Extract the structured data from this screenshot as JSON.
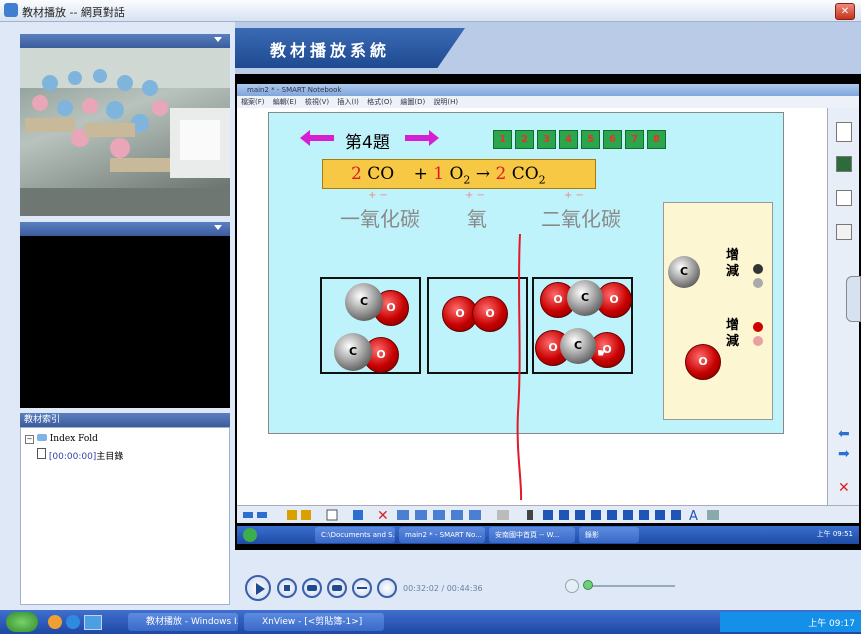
{
  "window": {
    "title": "教材播放 -- 網頁對話",
    "close_label": "✕"
  },
  "index": {
    "header": "教材索引",
    "folder": "Index Fold",
    "item_time": "[00:00:00]",
    "item_label": "主目錄"
  },
  "header": {
    "title": "教材播放系統"
  },
  "smart": {
    "title": "main2 * - SMART Notebook",
    "menu": [
      "檔案(F)",
      "編輯(E)",
      "檢視(V)",
      "插入(I)",
      "格式(O)",
      "繪圖(D)",
      "說明(H)"
    ]
  },
  "slide": {
    "question": "第4題",
    "page_buttons": [
      "1",
      "2",
      "3",
      "4",
      "5",
      "6",
      "7",
      "8"
    ],
    "equation": {
      "c1": "2",
      "t1": "CO",
      "plus": "+",
      "c2": "1",
      "t2": "O",
      "sub2": "2",
      "arrow": "→",
      "c3": "2",
      "t3": "CO",
      "sub3": "2"
    },
    "marks": [
      "+ −",
      "+ −",
      "+ −"
    ],
    "names": [
      "一氧化碳",
      "氧",
      "二氧化碳"
    ],
    "atom_c": "C",
    "atom_o": "O",
    "legend": {
      "label_c": "增\n減",
      "label_o": "增\n減"
    }
  },
  "inner_taskbar": {
    "items": [
      "C:\\Documents and S...",
      "main2 * - SMART No...",
      "安南國中首頁 -- W...",
      "錄影"
    ],
    "clock": "上午 09:51"
  },
  "player": {
    "time": "00:32:02 / 00:44:36"
  },
  "taskbar": {
    "items": [
      "教材播放 - Windows I...",
      "XnView - [<剪貼簿-1>]"
    ],
    "clock": "上午 09:17"
  },
  "colors": {
    "accent": "#1e4a90",
    "slide_bg": "#bff3fb",
    "equation_bg": "#f7c843",
    "magenta": "#d61fd2",
    "red_line": "#e0192b"
  }
}
